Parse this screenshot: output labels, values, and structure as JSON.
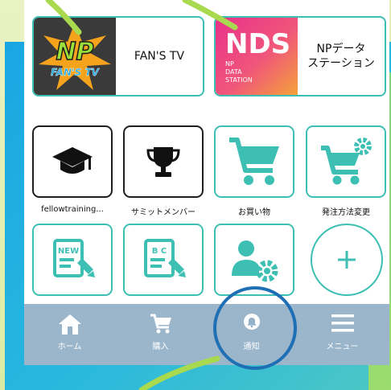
{
  "banners": [
    {
      "label": "FAN'S TV",
      "logo_text_top": "NP",
      "logo_text_bottom": "FAN'S TV"
    },
    {
      "label": "NPデータ\nステーション",
      "logo_text_top": "NDS",
      "logo_text_sub": "NP\nDATA\nSTATION"
    }
  ],
  "tiles": [
    {
      "caption": "fellowtraining...",
      "icon": "graduation-cap-icon",
      "style": "dark"
    },
    {
      "caption": "サミットメンバー",
      "icon": "trophy-icon",
      "style": "dark"
    },
    {
      "caption": "お買い物",
      "icon": "shopping-cart-icon",
      "style": "teal"
    },
    {
      "caption": "発注方法変更",
      "icon": "cart-settings-icon",
      "style": "teal"
    },
    {
      "caption": "",
      "icon": "new-document-edit-icon",
      "style": "teal",
      "badge": "NEW"
    },
    {
      "caption": "",
      "icon": "abc-document-edit-icon",
      "style": "teal",
      "badge": "B C"
    },
    {
      "caption": "",
      "icon": "user-settings-icon",
      "style": "teal"
    }
  ],
  "nav": [
    {
      "label": "ホーム",
      "icon": "home-icon"
    },
    {
      "label": "購入",
      "icon": "cart-icon"
    },
    {
      "label": "通知",
      "icon": "bell-icon"
    },
    {
      "label": "メニュー",
      "icon": "hamburger-menu-icon"
    }
  ],
  "colors": {
    "teal": "#3dbfb4",
    "nav_bg": "#96b2c8",
    "ring": "#1f6fb5",
    "accent_blue": "#1aa6e2"
  }
}
